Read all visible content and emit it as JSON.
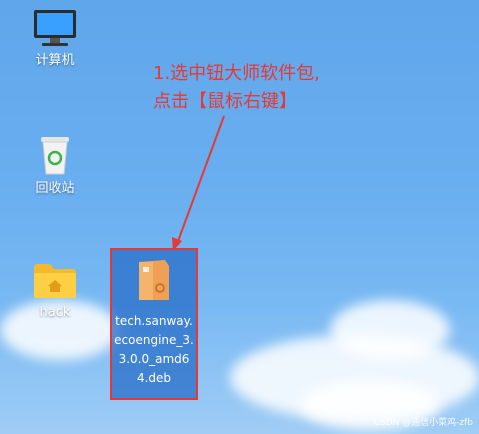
{
  "desktop": {
    "icons": {
      "computer": {
        "label": "计算机",
        "icon": "computer-monitor-icon"
      },
      "trash": {
        "label": "回收站",
        "icon": "recycle-bin-icon"
      },
      "hack": {
        "label": "hack",
        "icon": "folder-home-icon"
      },
      "deb": {
        "label": "tech.sanway.ecoengine_3.3.0.0_amd64.deb",
        "icon": "deb-package-icon",
        "selected": true
      }
    }
  },
  "annotation": {
    "line1": "1.选中钮大师软件包,",
    "line2": "点击【鼠标右键】",
    "color": "#e53935"
  },
  "watermark": "CSDN @通信小菜鸡-zfb"
}
